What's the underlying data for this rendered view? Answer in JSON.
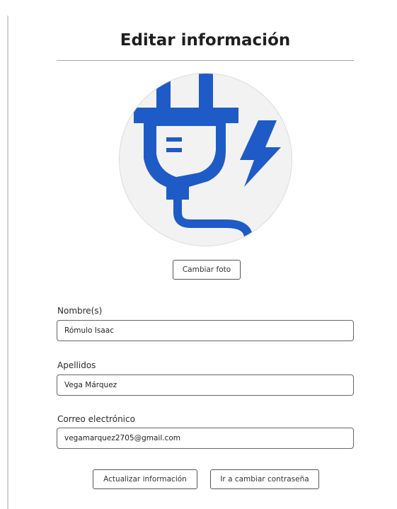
{
  "header": {
    "title": "Editar información"
  },
  "profile": {
    "avatar_icon": "electric-plug-icon",
    "avatar_color": "#1e5bc6",
    "change_photo_label": "Cambiar foto"
  },
  "form": {
    "first_name": {
      "label": "Nombre(s)",
      "value": "Rómulo Isaac"
    },
    "last_name": {
      "label": "Apellidos",
      "value": "Vega Márquez"
    },
    "email": {
      "label": "Correo electrónico",
      "value": "vegamarquez2705@gmail.com"
    }
  },
  "actions": {
    "update_label": "Actualizar información",
    "change_password_label": "Ir a cambiar contraseña"
  }
}
